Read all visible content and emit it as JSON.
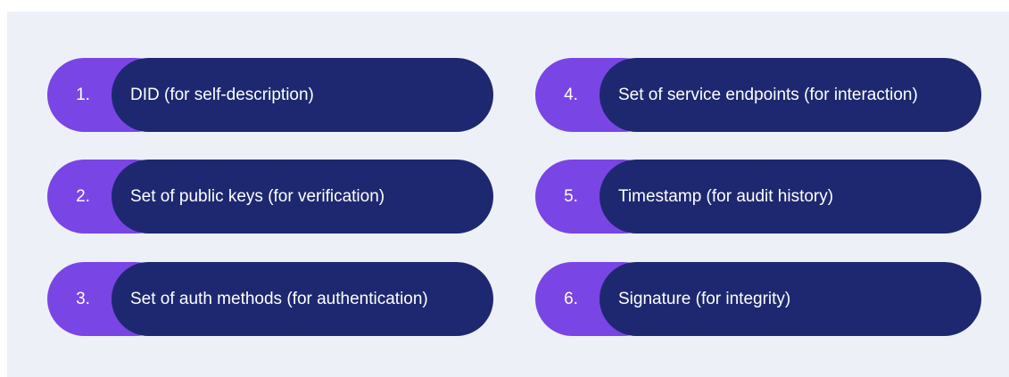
{
  "items": [
    {
      "num": "1.",
      "label": "DID (for self-description)"
    },
    {
      "num": "2.",
      "label": "Set of public keys (for verification)"
    },
    {
      "num": "3.",
      "label": "Set of auth methods (for authentication)"
    },
    {
      "num": "4.",
      "label": "Set of service endpoints (for interaction)"
    },
    {
      "num": "5.",
      "label": "Timestamp (for audit history)"
    },
    {
      "num": "6.",
      "label": "Signature (for integrity)"
    }
  ],
  "colors": {
    "background": "#edf0f7",
    "accent_purple": "#7a45e5",
    "navy": "#1e2870",
    "text": "#ffffff"
  }
}
